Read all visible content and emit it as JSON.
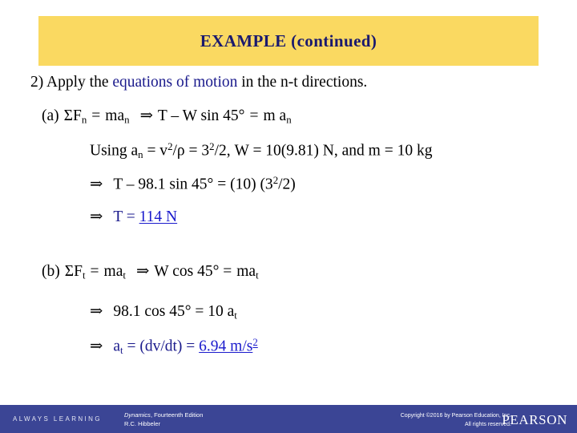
{
  "colors": {
    "banner_bg": "#fad961",
    "title_text": "#1a1a6e",
    "body_text": "#000000",
    "accent_blue": "#1a1a8c",
    "result_blue": "#1a1acc",
    "footer_bg": "#3b4595",
    "page_bg": "#ffffff"
  },
  "title": {
    "text": "EXAMPLE (continued)"
  },
  "body": {
    "step2": {
      "prefix": "2)  Apply the ",
      "highlight": "equations of motion",
      "suffix": " in the n-t directions."
    },
    "part_a": {
      "label": "(a)",
      "sum_symbol": "ΣF",
      "sum_sub": "n",
      "equals": "=",
      "ma": "ma",
      "ma_sub": "n",
      "implies": "⇒",
      "expression": "T – W sin 45°",
      "equals2": "=",
      "rhs": "m a",
      "rhs_sub": "n"
    },
    "using_line": {
      "lead": "Using a",
      "lead_sub": "n",
      "rest": " = v",
      "exp1": "2",
      "rest2": "/ρ = 3",
      "exp2": "2",
      "rest3": "/2, W = 10(9.81) N, and m = 10 kg"
    },
    "a_calc": {
      "implies": "⇒",
      "text": "T – 98.1 sin 45°  = (10) (3",
      "exp": "2",
      "text_end": "/2)"
    },
    "a_result": {
      "implies": "⇒",
      "lhs": "T = ",
      "value": "114 N"
    },
    "part_b": {
      "label": "(b)",
      "sum_symbol": "ΣF",
      "sum_sub": "t",
      "equals": "=",
      "ma": "ma",
      "ma_sub": "t",
      "implies": "⇒",
      "expression": "W cos 45° =",
      "rhs": "ma",
      "rhs_sub": "t"
    },
    "b_calc": {
      "implies": "⇒",
      "text": "98.1 cos 45° = 10 a",
      "sub": "t"
    },
    "b_result": {
      "implies": "⇒",
      "lhs_a": "a",
      "lhs_sub": "t",
      "lhs_rest": " = (dv/dt) = ",
      "value": "6.94 m/s",
      "value_exp": "2"
    }
  },
  "footer": {
    "always_learning": "ALWAYS LEARNING",
    "book_title": "Dynamics",
    "book_edition": ", Fourteenth Edition",
    "book_author": "R.C. Hibbeler",
    "copyright_line1": "Copyright ©2016 by Pearson Education, Inc.",
    "copyright_line2": "All rights reserved.",
    "brand": "PEARSON"
  }
}
